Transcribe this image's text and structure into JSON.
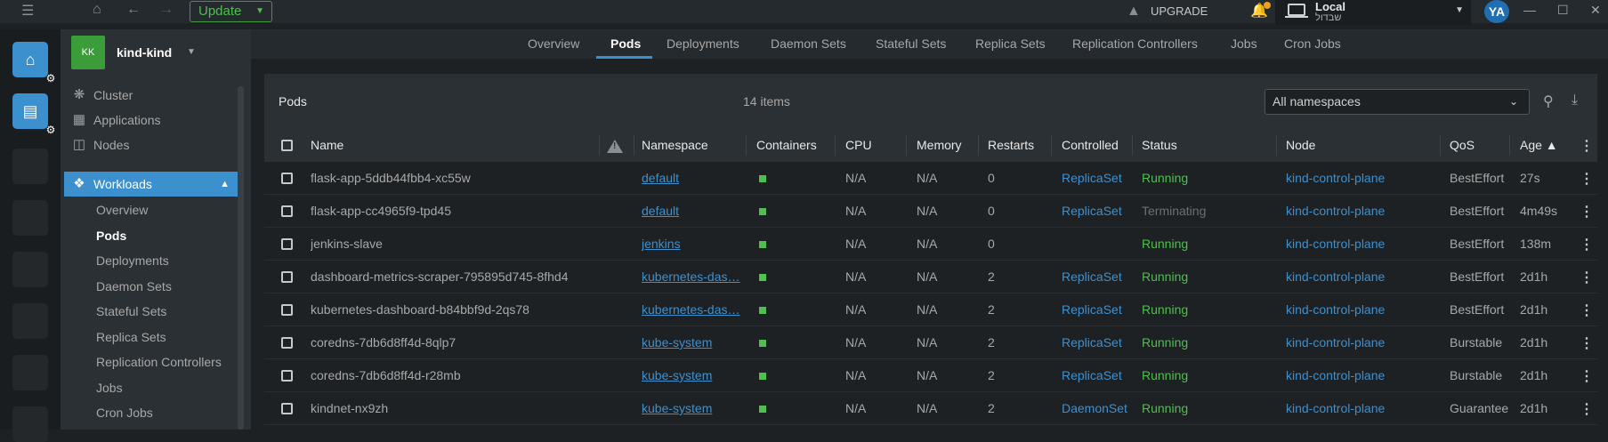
{
  "topbar": {
    "update_label": "Update",
    "upgrade_label": "UPGRADE",
    "context_name": "Local",
    "context_sub": "שבדול",
    "avatar_initials": "YA",
    "icons": [
      "hamburger-icon",
      "home-icon",
      "back-arrow-icon",
      "forward-arrow-icon",
      "bell-icon",
      "laptop-icon",
      "minimize-icon",
      "maximize-icon",
      "close-icon"
    ]
  },
  "cluster": {
    "badge": "KK",
    "name": "kind-kind"
  },
  "sidebar": {
    "items": [
      {
        "label": "Cluster",
        "icon": "cluster-icon"
      },
      {
        "label": "Applications",
        "icon": "grid-icon"
      },
      {
        "label": "Nodes",
        "icon": "nodes-icon"
      },
      {
        "label": "Workloads",
        "icon": "workloads-icon"
      }
    ],
    "workloads_sub": [
      "Overview",
      "Pods",
      "Deployments",
      "Daemon Sets",
      "Stateful Sets",
      "Replica Sets",
      "Replication Controllers",
      "Jobs",
      "Cron Jobs"
    ]
  },
  "tabs": [
    "Overview",
    "Pods",
    "Deployments",
    "Daemon Sets",
    "Stateful Sets",
    "Replica Sets",
    "Replication Controllers",
    "Jobs",
    "Cron Jobs"
  ],
  "panel": {
    "title": "Pods",
    "count": "14 items",
    "namespace_select": "All namespaces"
  },
  "table": {
    "headers": {
      "name": "Name",
      "namespace": "Namespace",
      "containers": "Containers",
      "cpu": "CPU",
      "memory": "Memory",
      "restarts": "Restarts",
      "controlled": "Controlled",
      "status": "Status",
      "node": "Node",
      "qos": "QoS",
      "age": "Age ▲"
    },
    "rows": [
      {
        "name": "flask-app-5ddb44fbb4-xc55w",
        "namespace": "default",
        "cpu": "N/A",
        "memory": "N/A",
        "restarts": "0",
        "controlled": "ReplicaSet",
        "status": "Running",
        "node": "kind-control-plane",
        "qos": "BestEffort",
        "age": "27s"
      },
      {
        "name": "flask-app-cc4965f9-tpd45",
        "namespace": "default",
        "cpu": "N/A",
        "memory": "N/A",
        "restarts": "0",
        "controlled": "ReplicaSet",
        "status": "Terminating",
        "node": "kind-control-plane",
        "qos": "BestEffort",
        "age": "4m49s"
      },
      {
        "name": "jenkins-slave",
        "namespace": "jenkins",
        "cpu": "N/A",
        "memory": "N/A",
        "restarts": "0",
        "controlled": "",
        "status": "Running",
        "node": "kind-control-plane",
        "qos": "BestEffort",
        "age": "138m"
      },
      {
        "name": "dashboard-metrics-scraper-795895d745-8fhd4",
        "namespace": "kubernetes-das…",
        "cpu": "N/A",
        "memory": "N/A",
        "restarts": "2",
        "controlled": "ReplicaSet",
        "status": "Running",
        "node": "kind-control-plane",
        "qos": "BestEffort",
        "age": "2d1h"
      },
      {
        "name": "kubernetes-dashboard-b84bbf9d-2qs78",
        "namespace": "kubernetes-das…",
        "cpu": "N/A",
        "memory": "N/A",
        "restarts": "2",
        "controlled": "ReplicaSet",
        "status": "Running",
        "node": "kind-control-plane",
        "qos": "BestEffort",
        "age": "2d1h"
      },
      {
        "name": "coredns-7db6d8ff4d-8qlp7",
        "namespace": "kube-system",
        "cpu": "N/A",
        "memory": "N/A",
        "restarts": "2",
        "controlled": "ReplicaSet",
        "status": "Running",
        "node": "kind-control-plane",
        "qos": "Burstable",
        "age": "2d1h"
      },
      {
        "name": "coredns-7db6d8ff4d-r28mb",
        "namespace": "kube-system",
        "cpu": "N/A",
        "memory": "N/A",
        "restarts": "2",
        "controlled": "ReplicaSet",
        "status": "Running",
        "node": "kind-control-plane",
        "qos": "Burstable",
        "age": "2d1h"
      },
      {
        "name": "kindnet-nx9zh",
        "namespace": "kube-system",
        "cpu": "N/A",
        "memory": "N/A",
        "restarts": "2",
        "controlled": "DaemonSet",
        "status": "Running",
        "node": "kind-control-plane",
        "qos": "Guarantee",
        "age": "2d1h"
      }
    ]
  },
  "colors": {
    "accent": "#3d90ce",
    "running": "#4fbf4f",
    "terminating": "#6b7075",
    "update_green": "#3d9a3d"
  }
}
